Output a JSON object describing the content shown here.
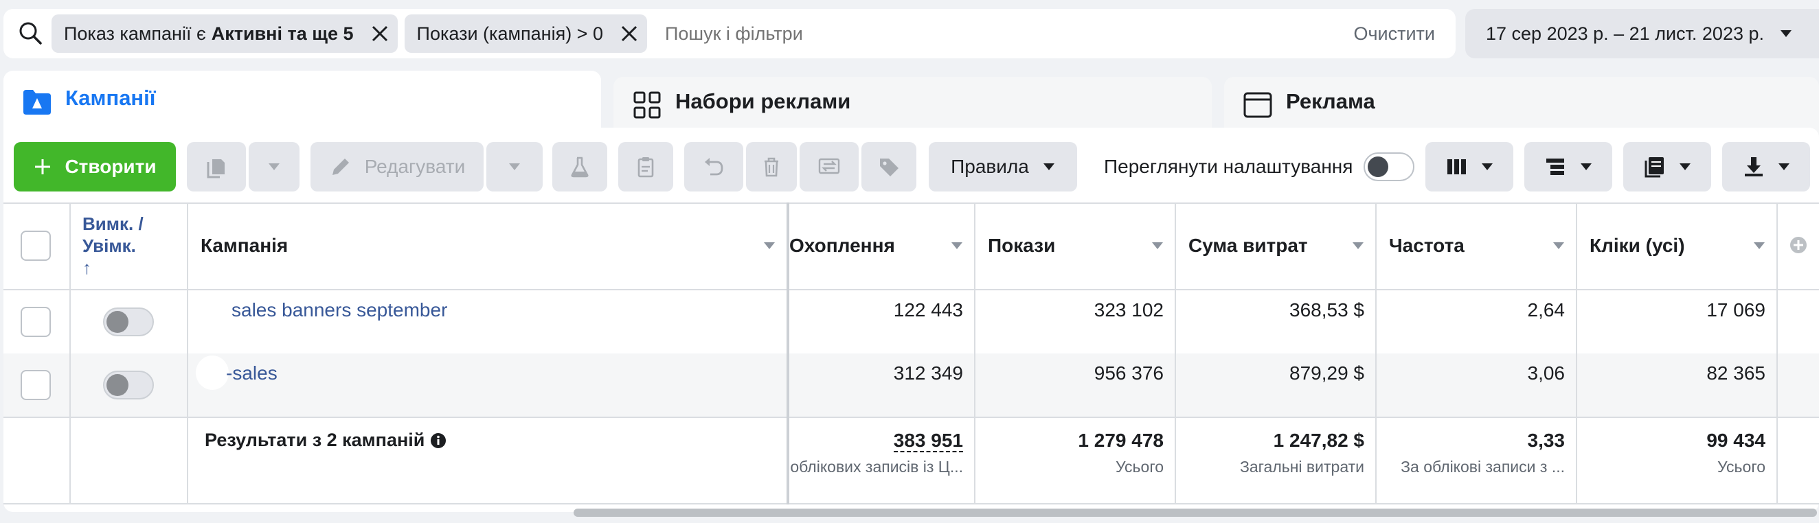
{
  "filters": {
    "chips": [
      {
        "prefix": "Показ кампанії є",
        "bold": "Активні та ще 5"
      },
      {
        "prefix": "Покази (кампанія) > 0",
        "bold": ""
      }
    ],
    "placeholder": "Пошук і фільтри",
    "clear_label": "Очистити"
  },
  "date_range": "17 сер 2023 р. – 21 лист. 2023 р.",
  "tabs": [
    {
      "label": "Кампанії",
      "active": true
    },
    {
      "label": "Набори реклами",
      "active": false
    },
    {
      "label": "Реклама",
      "active": false
    }
  ],
  "toolbar": {
    "create_label": "Створити",
    "edit_label": "Редагувати",
    "rules_label": "Правила",
    "view_settings_label": "Переглянути налаштування",
    "view_settings_on": false
  },
  "table": {
    "headers": {
      "toggle": "Вимк. / Увімк.",
      "toggle_sort": "↑",
      "campaign": "Кампанія",
      "reach": "Охоплення",
      "impressions": "Покази",
      "spend": "Сума витрат",
      "frequency": "Частота",
      "clicks": "Кліки (усі)"
    },
    "rows": [
      {
        "name": "sales banners september",
        "reach": "122 443",
        "impressions": "323 102",
        "spend": "368,53 $",
        "frequency": "2,64",
        "clicks": "17 069",
        "on": false
      },
      {
        "name": "-sales",
        "reach": "312 349",
        "impressions": "956 376",
        "spend": "879,29 $",
        "frequency": "3,06",
        "clicks": "82 365",
        "on": false
      }
    ],
    "totals": {
      "label": "Результати з 2 кампаній",
      "reach": "383 951",
      "reach_sub": "облікових записів із Ц...",
      "impressions": "1 279 478",
      "impressions_sub": "Усього",
      "spend": "1 247,82 $",
      "spend_sub": "Загальні витрати",
      "frequency": "3,33",
      "frequency_sub": "За облікові записи з ...",
      "clicks": "99 434",
      "clicks_sub": "Усього"
    }
  },
  "colors": {
    "accent": "#1877f2",
    "create_button": "#42b72a",
    "link": "#385898"
  }
}
